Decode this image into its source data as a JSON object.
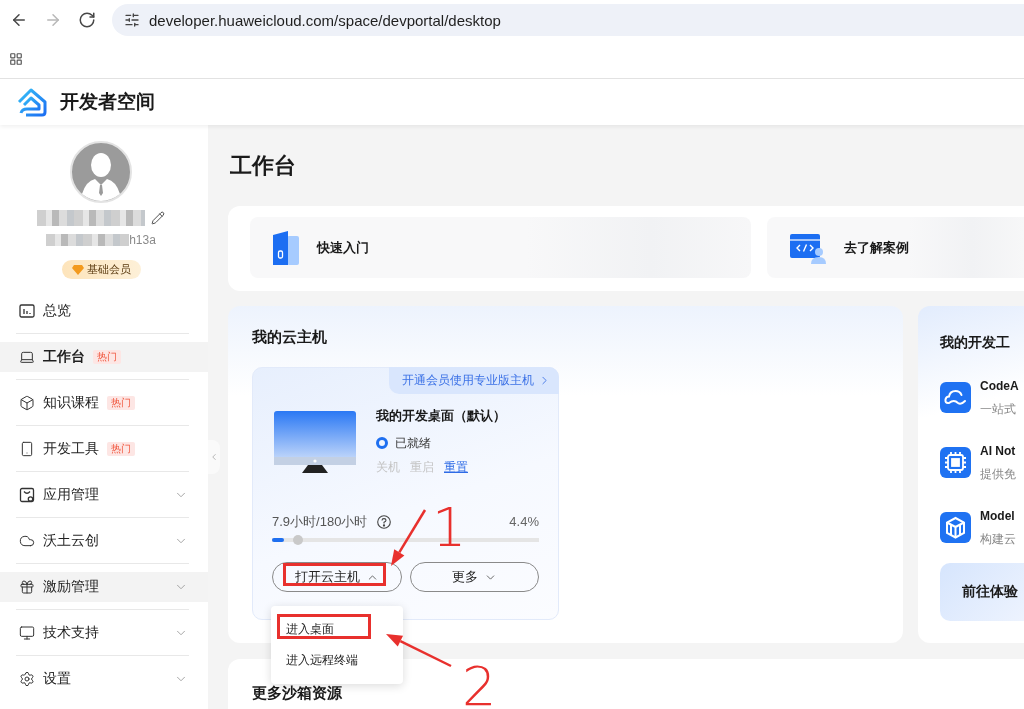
{
  "browser": {
    "nav_buttons": [
      {
        "kind": "back",
        "disabled": false
      },
      {
        "kind": "forward",
        "disabled": true
      },
      {
        "kind": "reload",
        "disabled": false
      }
    ],
    "url": "developer.huaweicloud.com/space/devportal/desktop"
  },
  "header": {
    "title": "开发者空间"
  },
  "sidebar": {
    "user": {
      "account_tail": "h13a",
      "membership": "基础会员"
    },
    "nav": [
      {
        "label": "总览",
        "kind": "page",
        "selected": false,
        "hovered": false
      },
      {
        "label": "工作台",
        "kind": "page",
        "badge": "热门",
        "selected": true,
        "hovered": false
      },
      {
        "label": "知识课程",
        "kind": "page",
        "badge": "热门",
        "selected": false,
        "hovered": false
      },
      {
        "label": "开发工具",
        "kind": "page",
        "badge": "热门",
        "selected": false,
        "hovered": false
      },
      {
        "label": "应用管理",
        "kind": "group",
        "expanded": false,
        "selected": false,
        "hovered": false
      },
      {
        "label": "沃土云创",
        "kind": "group",
        "expanded": false,
        "selected": false,
        "hovered": false
      },
      {
        "label": "激励管理",
        "kind": "group",
        "expanded": false,
        "selected": false,
        "hovered": true
      },
      {
        "label": "技术支持",
        "kind": "group",
        "expanded": false,
        "selected": false,
        "hovered": false
      },
      {
        "label": "设置",
        "kind": "group",
        "expanded": false,
        "selected": false,
        "hovered": false
      }
    ]
  },
  "page_title": "工作台",
  "quick_links": [
    {
      "label": "快速入门"
    },
    {
      "label": "去了解案例"
    }
  ],
  "cloud_host": {
    "title": "我的云主机",
    "promo": "开通会员使用专业版主机",
    "desktop": {
      "name": "我的开发桌面（默认）",
      "status": "已就绪",
      "actions": [
        {
          "label": "关机",
          "disabled": true
        },
        {
          "label": "重启",
          "disabled": true
        },
        {
          "label": "重置",
          "disabled": false
        }
      ]
    },
    "usage": {
      "reading": "7.9小时/180小时",
      "percent": "4.4%",
      "level": 0.044
    },
    "buttons": [
      {
        "label": "打开云主机",
        "expanded": true,
        "highlighted": true
      },
      {
        "label": "更多",
        "expanded": false,
        "highlighted": false
      }
    ],
    "menu": [
      {
        "label": "进入桌面",
        "highlighted": true
      },
      {
        "label": "进入远程终端",
        "highlighted": false
      }
    ],
    "annotations": [
      {
        "label": "1"
      },
      {
        "label": "2"
      }
    ]
  },
  "dev_tools": {
    "title": "我的开发工",
    "tools": [
      {
        "name": "CodeA",
        "description": "一站式"
      },
      {
        "name": "AI Not",
        "description": "提供免"
      },
      {
        "name": "Model",
        "description": "构建云"
      }
    ],
    "cta": "前往体验"
  },
  "sandbox": {
    "title": "更多沙箱资源"
  }
}
